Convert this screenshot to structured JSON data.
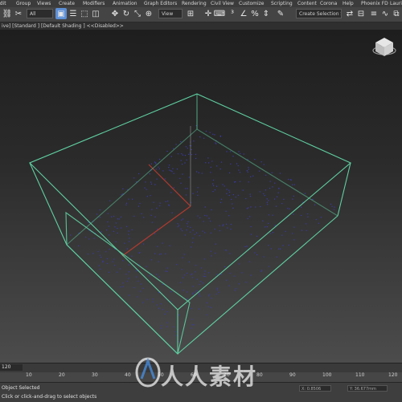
{
  "menu": {
    "items": [
      "Edit",
      "Group",
      "Views",
      "Create",
      "Modifiers",
      "Animation",
      "Graph Editors",
      "Rendering",
      "Civil View",
      "Customize",
      "Scripting",
      "Content",
      "Corona",
      "Help",
      "Phoenix FD",
      "Lauri"
    ]
  },
  "toolbar": {
    "filter_value": "All",
    "view_value": "View",
    "selection_set_placeholder": "Create Selection Se"
  },
  "viewport": {
    "label": "[+] [Perspective] [Standard] [Default Shading] <<Disabled>>",
    "label_visible": "ive] [Standard ] [Default Shading ] <<Disabled>>"
  },
  "timeline": {
    "frame_counter": "120",
    "ticks": [
      "10",
      "20",
      "30",
      "40",
      "50",
      "60",
      "70",
      "80",
      "90",
      "100",
      "110",
      "120"
    ]
  },
  "status": {
    "line1": "Object Selected",
    "line2": "Click or click-and-drag to select objects",
    "coord_x": "X: 0.8506",
    "coord_y": "Y: 36.677mm"
  },
  "watermark": {
    "text": "人人素材"
  },
  "colors": {
    "wire": "#5fd0a2",
    "axis_red": "#b03a2e",
    "particles": "#3a3aa8"
  }
}
